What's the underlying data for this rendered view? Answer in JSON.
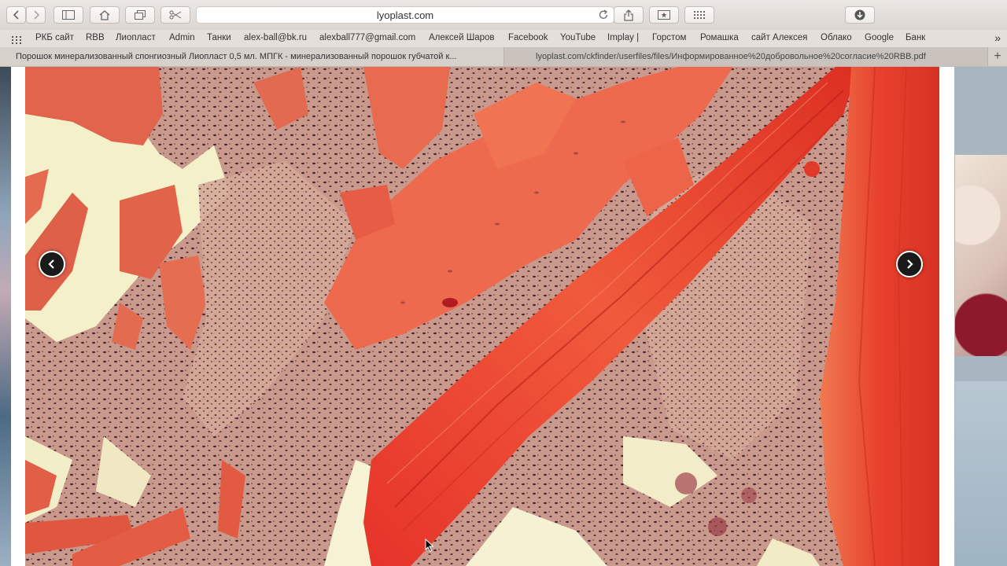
{
  "browser": {
    "url": "lyoplast.com",
    "bookmarks": [
      "РКБ сайт",
      "RBB",
      "Лиопласт",
      "Admin",
      "Танки",
      "alex-ball@bk.ru",
      "alexball777@gmail.com",
      "Алексей Шаров",
      "Facebook",
      "YouTube",
      "Implay |",
      "Горстом",
      "Ромашка",
      "сайт Алексея",
      "Облако",
      "Google",
      "Банк"
    ],
    "tabs": [
      {
        "title": "Порошок минерализованный спонгиозный Лиопласт 0,5 мл. МПГК - минерализованный порошок губчатой к...",
        "active": true
      },
      {
        "title": "lyoplast.com/ckfinder/userfiles/files/Информированное%20добровольное%20согласие%20RBB.pdf",
        "active": false
      }
    ]
  },
  "icons": {
    "back": "chevron-left-icon",
    "forward": "chevron-right-icon",
    "sidebar": "sidebar-icon",
    "home": "home-icon",
    "tabs": "tab-overview-icon",
    "clip": "scissors-icon",
    "reload": "reload-icon",
    "share": "share-icon",
    "bookmark": "bookmark-star-icon",
    "grid": "top-sites-icon",
    "download": "download-icon",
    "lightbox_prev": "chevron-left-icon",
    "lightbox_next": "chevron-right-icon"
  },
  "colors": {
    "tissue_background": "#f3efc8",
    "bone_red": "#e8452c",
    "muscle_red": "#e26a52",
    "stroma": "#c89a8e"
  }
}
